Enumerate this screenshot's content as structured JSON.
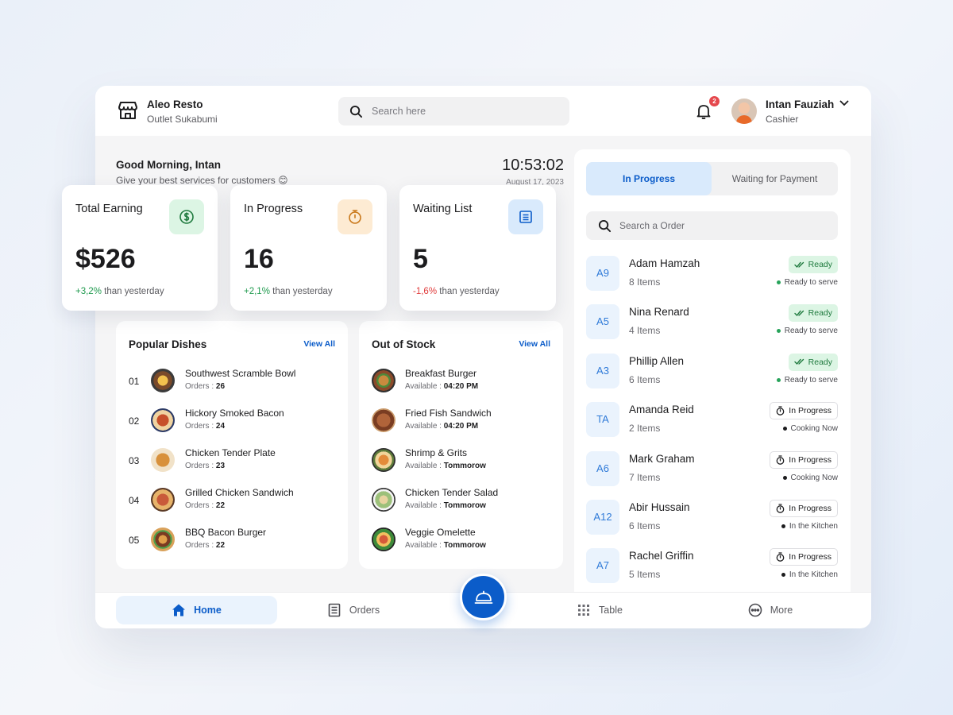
{
  "brand": {
    "name": "Aleo Resto",
    "outlet": "Outlet Sukabumi"
  },
  "search": {
    "placeholder": "Search here"
  },
  "notifications": {
    "count": "2"
  },
  "user": {
    "name": "Intan Fauziah",
    "role": "Cashier"
  },
  "greeting": {
    "title": "Good Morning, Intan",
    "subtitle": "Give your best services for customers 😊"
  },
  "clock": {
    "time": "10:53:02",
    "date": "August 17, 2023"
  },
  "stats": [
    {
      "title": "Total Earning",
      "value": "$526",
      "change": "+3,2%",
      "change_suffix": "than yesterday",
      "trend": "up",
      "icon": "dollar-icon",
      "color": "#dcf5e4"
    },
    {
      "title": "In Progress",
      "value": "16",
      "change": "+2,1%",
      "change_suffix": "than yesterday",
      "trend": "up",
      "icon": "stopwatch-icon",
      "color": "#fdebd3"
    },
    {
      "title": "Waiting List",
      "value": "5",
      "change": "-1,6%",
      "change_suffix": "than yesterday",
      "trend": "down",
      "icon": "document-icon",
      "color": "#d9eafc"
    }
  ],
  "popular": {
    "title": "Popular Dishes",
    "view_all": "View All",
    "meta_label": "Orders :",
    "items": [
      {
        "rank": "01",
        "name": "Southwest Scramble Bowl",
        "orders": "26"
      },
      {
        "rank": "02",
        "name": "Hickory Smoked Bacon",
        "orders": "24"
      },
      {
        "rank": "03",
        "name": "Chicken Tender Plate",
        "orders": "23"
      },
      {
        "rank": "04",
        "name": "Grilled Chicken Sandwich",
        "orders": "22"
      },
      {
        "rank": "05",
        "name": "BBQ Bacon Burger",
        "orders": "22"
      }
    ]
  },
  "stock": {
    "title": "Out of Stock",
    "view_all": "View All",
    "meta_label": "Available :",
    "items": [
      {
        "name": "Breakfast Burger",
        "available": "04:20 PM"
      },
      {
        "name": "Fried Fish Sandwich",
        "available": "04:20 PM"
      },
      {
        "name": "Shrimp & Grits",
        "available": "Tommorow"
      },
      {
        "name": "Chicken Tender Salad",
        "available": "Tommorow"
      },
      {
        "name": "Veggie Omelette",
        "available": "Tommorow"
      }
    ]
  },
  "orders_panel": {
    "tabs": [
      "In Progress",
      "Waiting for Payment"
    ],
    "search_placeholder": "Search a Order",
    "orders": [
      {
        "id": "A9",
        "name": "Adam Hamzah",
        "items": "8 Items",
        "status": "Ready",
        "sub": "Ready to serve",
        "type": "ready"
      },
      {
        "id": "A5",
        "name": "Nina Renard",
        "items": "4 Items",
        "status": "Ready",
        "sub": "Ready to serve",
        "type": "ready"
      },
      {
        "id": "A3",
        "name": "Phillip Allen",
        "items": "6 Items",
        "status": "Ready",
        "sub": "Ready to serve",
        "type": "ready"
      },
      {
        "id": "TA",
        "name": "Amanda Reid",
        "items": "2 Items",
        "status": "In Progress",
        "sub": "Cooking Now",
        "type": "progress"
      },
      {
        "id": "A6",
        "name": "Mark Graham",
        "items": "7 Items",
        "status": "In Progress",
        "sub": "Cooking Now",
        "type": "progress"
      },
      {
        "id": "A12",
        "name": "Abir Hussain",
        "items": "6 Items",
        "status": "In Progress",
        "sub": "In the Kitchen",
        "type": "progress"
      },
      {
        "id": "A7",
        "name": "Rachel Griffin",
        "items": "5 Items",
        "status": "In Progress",
        "sub": "In the Kitchen",
        "type": "progress"
      }
    ]
  },
  "nav": {
    "home": "Home",
    "orders": "Orders",
    "table": "Table",
    "more": "More"
  },
  "colors": {
    "accent": "#0b5cc9",
    "success": "#1f9a4e",
    "danger": "#e03b3b"
  }
}
